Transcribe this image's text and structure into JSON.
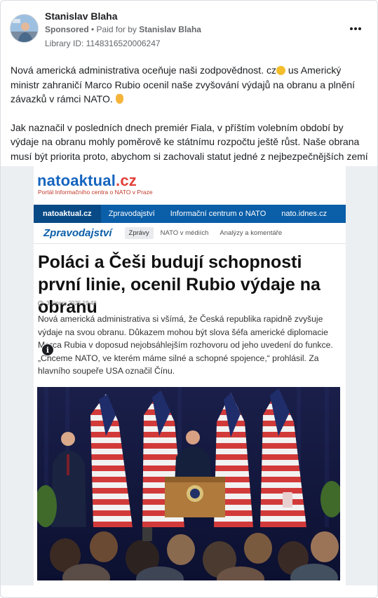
{
  "post": {
    "author": "Stanislav Blaha",
    "sponsored": "Sponsored",
    "paid_for_prefix": " • Paid for by ",
    "payer": "Stanislav Blaha",
    "library_id": "Library ID: 1148316520006247",
    "more_icon": "ellipsis-icon",
    "text_p1_a": "Nová americká administrativa oceňuje naši zodpovědnost. cz",
    "text_p1_b": " us Americký ministr zahraničí Marco Rubio ocenil naše zvyšování výdajů na obranu a plnění závazků v rámci NATO. ",
    "text_p2": "Jak naznačil v posledních dnech premiér Fiala, v příštím volebním období by výdaje na obranu mohly poměrově ke státnímu rozpočtu ještě růst. Naše obrana musí být priorita proto, abychom si zachovali statut jedné z nejbezpečnějších zemí na svět...",
    "emoji_handshake": "handshake-emoji",
    "emoji_thumbs": "thumbs-up-emoji"
  },
  "creative": {
    "logo_main": "natoaktual",
    "logo_tld": ".cz",
    "tagline": "Portál Informačního centra o NATO v Praze",
    "nav": [
      "natoaktual.cz",
      "Zpravodajství",
      "Informační centrum o NATO",
      "nato.idnes.cz"
    ],
    "section": "Zpravodajství",
    "tabs": [
      "Zprávy",
      "NATO v médiích",
      "Analýzy a komentáře"
    ],
    "headline": "Poláci a Češi budují schopnosti první linie, ocenil Rubio výdaje na obranu",
    "date": "3. února 2025  19:48",
    "lead": "Nová americká administrativa si všímá, že Česká republika rapidně zvyšuje výdaje na svou obranu. Důkazem mohou být slova šéfa americké diplomacie Marca Rubia v doposud nejobsáhlejším rozhovoru od jeho uvedení do funkce. „Chceme NATO, ve kterém máme silné a schopné spojence,“ prohlásil. Za hlavního soupeře USA označil Čínu.",
    "info_icon": "i"
  },
  "colors": {
    "brand_blue": "#0b5ea8",
    "logo_red": "#e2403a",
    "text_primary": "#1c1e21",
    "text_secondary": "#65676b"
  }
}
